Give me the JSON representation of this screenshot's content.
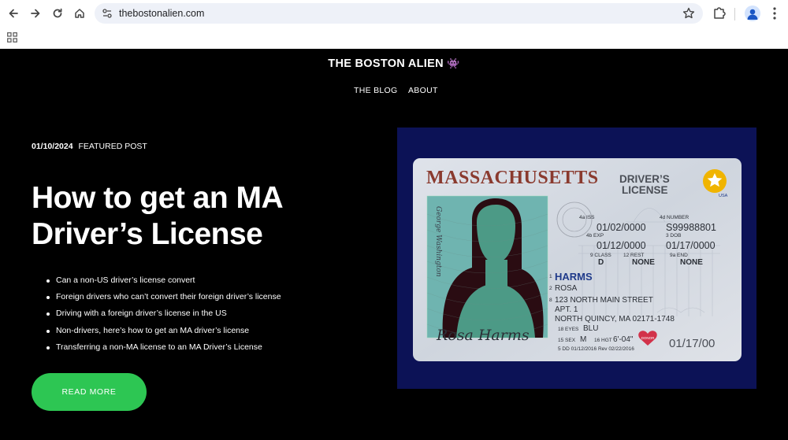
{
  "browser": {
    "url": "thebostonalien.com"
  },
  "site": {
    "brand": "THE BOSTON ALIEN",
    "brand_emoji": "👾",
    "menu": [
      {
        "label": "THE BLOG"
      },
      {
        "label": "ABOUT"
      }
    ]
  },
  "post": {
    "date": "01/10/2024",
    "tag": "FEATURED POST",
    "title_line1": "How to get an MA",
    "title_line2": "Driver’s License",
    "bullets": [
      "Can a non-US driver’s license convert",
      "Foreign drivers who can’t convert their foreign driver’s license",
      "Driving with a foreign driver’s license in the US",
      "Non-drivers, here’s how to get an MA driver’s license",
      "Transferring a non-MA license to an MA Driver’s License"
    ],
    "cta": "READ MORE"
  },
  "license": {
    "state": "MASSACHUSETTS",
    "doc_line1": "DRIVER’S",
    "doc_line2": "LICENSE",
    "usa": "USA",
    "iss_label": "4a ISS",
    "iss": "01/02/0000",
    "number_label": "4d NUMBER",
    "number": "S99988801",
    "exp_label": "4b EXP",
    "exp": "01/12/0000",
    "dob_label": "3 DOB",
    "dob": "01/17/0000",
    "class_label": "9 CLASS",
    "class": "D",
    "rest_label": "12 REST",
    "rest": "NONE",
    "end_label": "9a END",
    "end": "NONE",
    "last_label": "1",
    "last": "HARMS",
    "first_label": "2",
    "first": "ROSA",
    "addr_label": "8",
    "addr1": "123 NORTH MAIN STREET",
    "addr2": "APT. 1",
    "addr3": "NORTH QUINCY, MA 02171-1748",
    "eyes_label": "18 EYES",
    "eyes": "BLU",
    "sex_label": "15 SEX",
    "sex": "M",
    "hgt_label": "16 HGT",
    "hgt": "6'-04\"",
    "donor": "DONOR",
    "dd": "5 DD 01/12/2016 Rev 02/22/2016",
    "dob_small": "01/17/00",
    "signature": "Rosa Harms",
    "side_signature": "George Washington"
  },
  "colors": {
    "cta": "#2dc653",
    "feature_bg": "#0c1256",
    "license_title": "#8a3a2e",
    "license_name": "#1f3a8a"
  },
  "icons": [
    "back-arrow-icon",
    "forward-arrow-icon",
    "reload-icon",
    "home-icon",
    "site-settings-icon",
    "bookmark-star-icon",
    "extensions-icon",
    "profile-icon",
    "more-vert-icon",
    "apps-grid-icon"
  ]
}
